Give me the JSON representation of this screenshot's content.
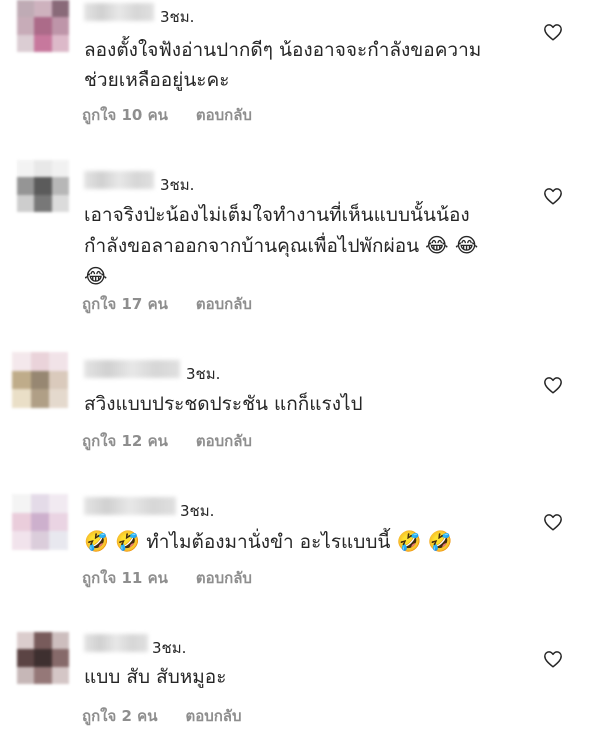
{
  "comments": [
    {
      "time": "3ชม.",
      "lines": [
        "ลองตั้งใจฟังอ่านปากดีๆ น้องอาจจะกำลังขอความ",
        "ช่วยเหลืออยู่นะคะ"
      ],
      "likes": "ถูกใจ 10 คน",
      "reply": "ตอบกลับ",
      "avatar_colors": [
        "#b9a3ad",
        "#c9aab8",
        "#7d5a6b",
        "#c2a4b1",
        "#a45b7d",
        "#b88aa0",
        "#d8c8cf",
        "#c26a93",
        "#d9b2c4"
      ]
    },
    {
      "time": "3ชม.",
      "lines": [
        "เอาจริงป่ะน้องไม่เต็มใจทำงานที่เห็นแบบนั้นน้อง",
        "กำลังขอลาออกจากบ้านคุณเพื่อไปพักผ่อน",
        ""
      ],
      "emoji_line2": "😂 😂",
      "emoji_line3": "😂",
      "likes": "ถูกใจ 17 คน",
      "reply": "ตอบกลับ",
      "avatar_colors": [
        "#f2f2f2",
        "#e6e6e6",
        "#f0f0f0",
        "#8a8a8a",
        "#4a4a4a",
        "#b0b0b0",
        "#c8c8c8",
        "#6a6a6a",
        "#d8d8d8"
      ]
    },
    {
      "time": "3ชม.",
      "lines": [
        "สวิงแบบประชดประชัน แกก็แรงไป"
      ],
      "likes": "ถูกใจ 12 คน",
      "reply": "ตอบกลับ",
      "avatar_colors": [
        "#f3e6ea",
        "#e8cfd6",
        "#f0e0e6",
        "#b9a47e",
        "#8c7b63",
        "#d6c5b5",
        "#e8dcc2",
        "#a8957a",
        "#e2d5c8"
      ]
    },
    {
      "time": "3ชม.",
      "lines": [
        "ทำไมต้องมานั่งขำ อะไรแบบนี้"
      ],
      "emoji_before": "🤣 🤣",
      "emoji_after": "🤣 🤣",
      "likes": "ถูกใจ 11 คน",
      "reply": "ตอบกลับ",
      "avatar_colors": [
        "#f3f3f3",
        "#e2d8e6",
        "#f0e8f0",
        "#e8c8d8",
        "#c8a8c8",
        "#e8d0e0",
        "#f0e0ea",
        "#d8c8d8",
        "#e6e6ee"
      ]
    },
    {
      "time": "3ชม.",
      "lines": [
        "แบบ สับ สับหมูอะ"
      ],
      "likes": "ถูกใจ 2 คน",
      "reply": "ตอบกลับ",
      "avatar_colors": [
        "#d8c8c8",
        "#6a4a4a",
        "#c8b8b8",
        "#4a3030",
        "#2a1a1a",
        "#7a5a5a",
        "#c0b0b0",
        "#8a6a6a",
        "#d0c0c0"
      ]
    }
  ]
}
